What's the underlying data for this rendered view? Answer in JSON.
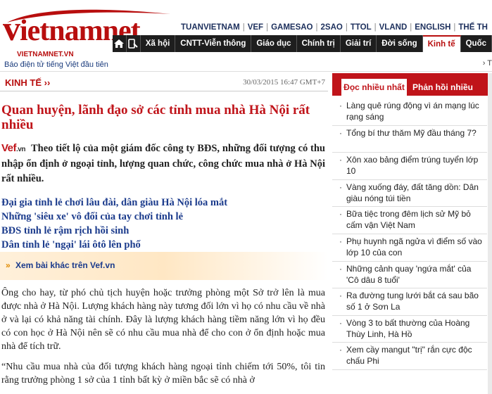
{
  "logo": {
    "wordmark_v": "v",
    "wordmark_rest": "ietnamnet",
    "sub": "VIETNAMNET.VN",
    "tagline": "Báo điện tử tiếng Việt đầu tiên"
  },
  "topnav": [
    "TUANVIETNAM",
    "VEF",
    "GAMESAO",
    "2SAO",
    "TTOL",
    "VLAND",
    "ENGLISH",
    "THẾ TH"
  ],
  "mainnav": {
    "icons": [
      "home-icon",
      "mobile-icon"
    ],
    "items": [
      "Xã hội",
      "CNTT-Viễn thông",
      "Giáo dục",
      "Chính trị",
      "Giải trí",
      "Đời sống",
      "Kinh tế",
      "Quốc"
    ],
    "active": "Kinh tế"
  },
  "subbar": {
    "right_text": "› T"
  },
  "article": {
    "category": "KINH TẾ ››",
    "date": "30/03/2015 16:47 GMT+7",
    "title": "Quan huyện, lãnh đạo sở các tỉnh mua nhà Hà Nội rất nhiều",
    "source_logo": "Vef",
    "source_logo_suffix": ".vn",
    "lead": "Theo tiết lộ của một giám đốc công ty BĐS, những đối tượng có thu nhập ổn định ở ngoại tỉnh, lượng quan chức, công chức mua nhà ở Hà Nội rất nhiều.",
    "related": [
      "Đại gia tỉnh lẻ chơi lâu đài, dân giàu Hà Nội lóa mắt",
      "Những 'siêu xe' vô đối của tay chơi tỉnh lẻ",
      "BĐS tỉnh lẻ rậm rịch hồi sinh",
      "Dân tỉnh lẻ 'ngại' lái ôtô lên phố"
    ],
    "more_icon": "»",
    "more_label": "Xem bài khác trên Vef.vn",
    "paragraphs": [
      "Ông cho hay, từ phó chủ tịch huyện hoặc trưởng phòng một Sở trở lên là mua được nhà ở Hà Nội. Lượng khách hàng này tương đối lớn vì họ có nhu cầu về nhà ở và lại có khả năng tài chính. Đây là lượng khách hàng tiềm năng lớn vì họ đều có con học ở Hà Nội nên sẽ có nhu cầu mua nhà để cho con ở ổn định hoặc mua nhà để tích trữ.",
      "“Nhu cầu mua nhà của đối tượng khách hàng ngoại tỉnh chiếm tới 50%, tôi tin rằng trưởng phòng 1 sở của 1 tỉnh bất kỳ ở miền bắc sẽ có nhà ở"
    ]
  },
  "sidebar": {
    "tab_popular": "Đọc nhiều nhất",
    "tab_feedback": "Phản hồi nhiều",
    "bullet": "·",
    "popular": [
      "Làng quê rúng động vì án mạng lúc rạng sáng",
      "Tổng bí thư thăm Mỹ đầu tháng 7?",
      "Xôn xao bảng điểm trúng tuyển lớp 10",
      "Vàng xuống đáy, đất tăng dồn: Dân giàu nóng túi tiền",
      "Bữa tiệc trong đêm lịch sử Mỹ bỏ cấm vận Việt Nam",
      "Phụ huynh ngã ngửa vì điểm số vào lớp 10 của con",
      "Những cảnh quay 'ngứa mắt' của 'Cô dâu 8 tuổi'",
      "Ra đường tung lưới bắt cá sau bão số 1 ở Sơn La",
      "Vòng 3 to bất thường của Hoàng Thùy Linh, Hà Hồ",
      "Xem cầy mangut \"trị\" rắn cực độc chấu Phi"
    ]
  },
  "colors": {
    "brand_red": "#c0141a",
    "nav_dark": "#1e1e1e",
    "link_blue": "#1b3b8c"
  }
}
